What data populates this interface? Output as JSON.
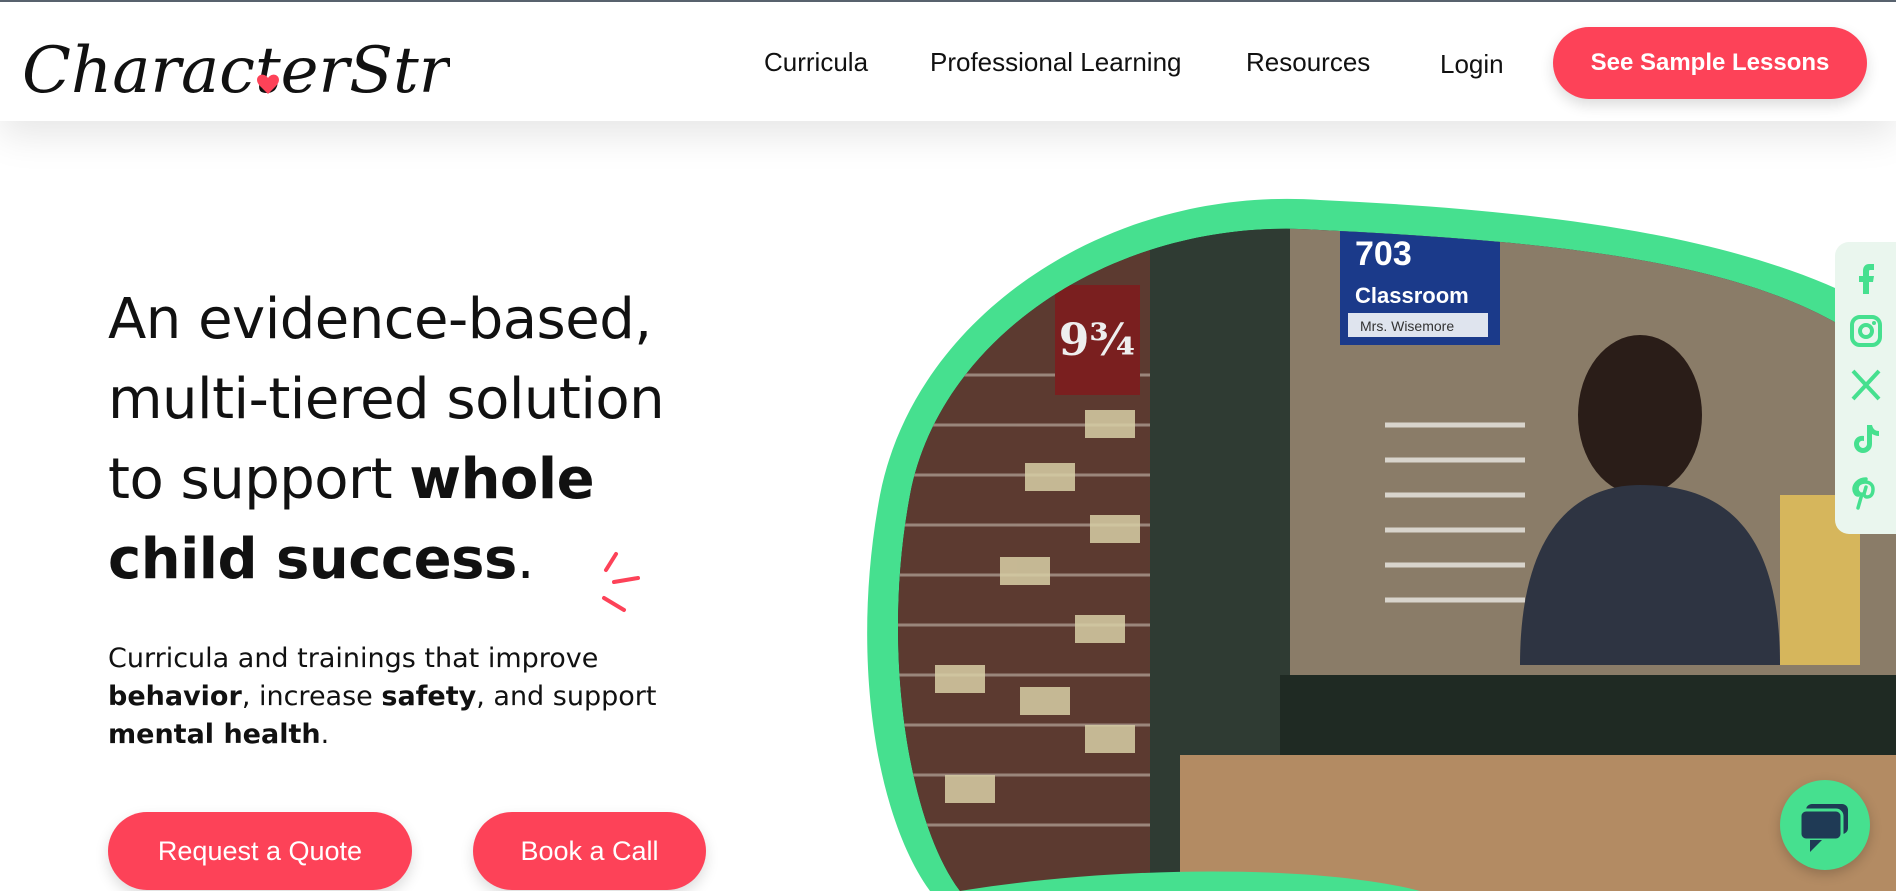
{
  "brand": {
    "name": "CharacterStrong",
    "logo_color": "#111111",
    "heart_color": "#fd4258"
  },
  "nav": {
    "items": [
      {
        "label": "Curricula"
      },
      {
        "label": "Professional Learning"
      },
      {
        "label": "Resources"
      },
      {
        "label": "Login"
      }
    ],
    "cta_label": "See Sample Lessons"
  },
  "hero": {
    "headline_line1": "An evidence-based,",
    "headline_line2": "multi-tiered solution",
    "headline_line3_plain": "to support ",
    "headline_line3_bold": "whole",
    "headline_line4_bold": "child success",
    "headline_period": ".",
    "sub_part1": "Curricula and trainings that improve",
    "sub_bold1": "behavior",
    "sub_part2": ", increase ",
    "sub_bold2": "safety",
    "sub_part3": ", and support",
    "sub_bold3": "mental health",
    "sub_end": ".",
    "quote_button": "Request a Quote",
    "call_button": "Book a Call"
  },
  "video": {
    "sign_number": "703",
    "sign_label": "Classroom",
    "name_plate": "Mrs. Wisemore",
    "platform_sign": "9¾",
    "frame_color": "#46e08f"
  },
  "social": {
    "icons": [
      "facebook-icon",
      "instagram-icon",
      "x-icon",
      "tiktok-icon",
      "pinterest-icon"
    ],
    "color": "#46e08f"
  },
  "colors": {
    "accent": "#fd4258",
    "green": "#46e08f"
  }
}
